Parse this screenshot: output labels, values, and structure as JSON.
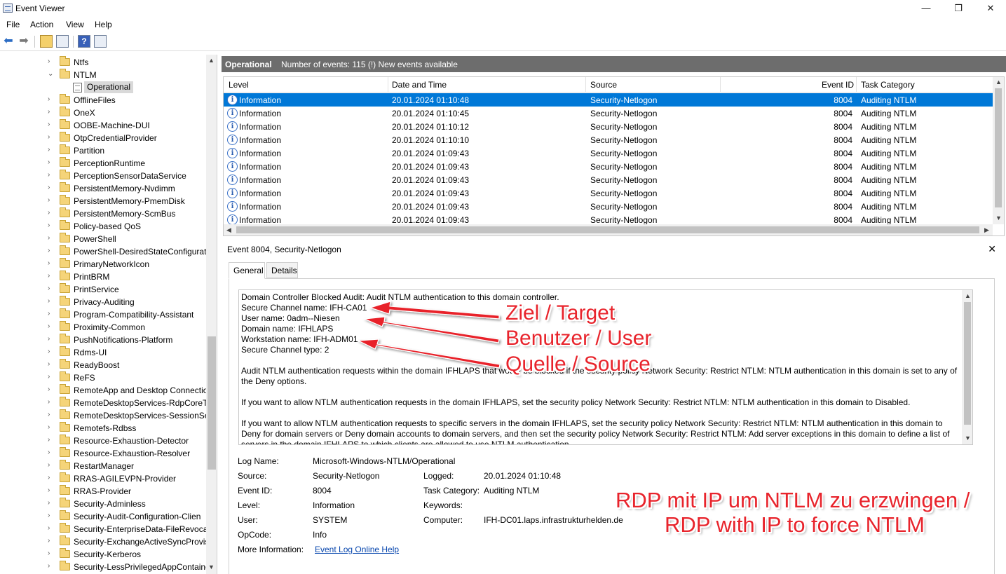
{
  "window": {
    "title": "Event Viewer",
    "minimize": "—",
    "maximize": "❐",
    "close": "✕"
  },
  "menu": [
    "File",
    "Action",
    "View",
    "Help"
  ],
  "tree": {
    "items": [
      {
        "label": "Ntfs",
        "expanded": false
      },
      {
        "label": "NTLM",
        "expanded": true
      },
      {
        "label": "Operational",
        "selected": true
      },
      {
        "label": "OfflineFiles"
      },
      {
        "label": "OneX"
      },
      {
        "label": "OOBE-Machine-DUI"
      },
      {
        "label": "OtpCredentialProvider"
      },
      {
        "label": "Partition"
      },
      {
        "label": "PerceptionRuntime"
      },
      {
        "label": "PerceptionSensorDataService"
      },
      {
        "label": "PersistentMemory-Nvdimm"
      },
      {
        "label": "PersistentMemory-PmemDisk"
      },
      {
        "label": "PersistentMemory-ScmBus"
      },
      {
        "label": "Policy-based QoS"
      },
      {
        "label": "PowerShell"
      },
      {
        "label": "PowerShell-DesiredStateConfigurati"
      },
      {
        "label": "PrimaryNetworkIcon"
      },
      {
        "label": "PrintBRM"
      },
      {
        "label": "PrintService"
      },
      {
        "label": "Privacy-Auditing"
      },
      {
        "label": "Program-Compatibility-Assistant"
      },
      {
        "label": "Proximity-Common"
      },
      {
        "label": "PushNotifications-Platform"
      },
      {
        "label": "Rdms-UI"
      },
      {
        "label": "ReadyBoost"
      },
      {
        "label": "ReFS"
      },
      {
        "label": "RemoteApp and Desktop Connectio"
      },
      {
        "label": "RemoteDesktopServices-RdpCoreTS"
      },
      {
        "label": "RemoteDesktopServices-SessionSer"
      },
      {
        "label": "Remotefs-Rdbss"
      },
      {
        "label": "Resource-Exhaustion-Detector"
      },
      {
        "label": "Resource-Exhaustion-Resolver"
      },
      {
        "label": "RestartManager"
      },
      {
        "label": "RRAS-AGILEVPN-Provider"
      },
      {
        "label": "RRAS-Provider"
      },
      {
        "label": "Security-Adminless"
      },
      {
        "label": "Security-Audit-Configuration-Clien"
      },
      {
        "label": "Security-EnterpriseData-FileRevocat"
      },
      {
        "label": "Security-ExchangeActiveSyncProvis"
      },
      {
        "label": "Security-Kerberos"
      },
      {
        "label": "Security-LessPrivilegedAppContainer"
      }
    ]
  },
  "log_header": {
    "name": "Operational",
    "summary": "Number of events: 115 (!) New events available"
  },
  "grid": {
    "columns": [
      "Level",
      "Date and Time",
      "Source",
      "Event ID",
      "Task Category"
    ],
    "rows": [
      {
        "level": "Information",
        "date": "20.01.2024 01:10:48",
        "source": "Security-Netlogon",
        "id": "8004",
        "cat": "Auditing NTLM",
        "selected": true
      },
      {
        "level": "Information",
        "date": "20.01.2024 01:10:45",
        "source": "Security-Netlogon",
        "id": "8004",
        "cat": "Auditing NTLM"
      },
      {
        "level": "Information",
        "date": "20.01.2024 01:10:12",
        "source": "Security-Netlogon",
        "id": "8004",
        "cat": "Auditing NTLM"
      },
      {
        "level": "Information",
        "date": "20.01.2024 01:10:10",
        "source": "Security-Netlogon",
        "id": "8004",
        "cat": "Auditing NTLM"
      },
      {
        "level": "Information",
        "date": "20.01.2024 01:09:43",
        "source": "Security-Netlogon",
        "id": "8004",
        "cat": "Auditing NTLM"
      },
      {
        "level": "Information",
        "date": "20.01.2024 01:09:43",
        "source": "Security-Netlogon",
        "id": "8004",
        "cat": "Auditing NTLM"
      },
      {
        "level": "Information",
        "date": "20.01.2024 01:09:43",
        "source": "Security-Netlogon",
        "id": "8004",
        "cat": "Auditing NTLM"
      },
      {
        "level": "Information",
        "date": "20.01.2024 01:09:43",
        "source": "Security-Netlogon",
        "id": "8004",
        "cat": "Auditing NTLM"
      },
      {
        "level": "Information",
        "date": "20.01.2024 01:09:43",
        "source": "Security-Netlogon",
        "id": "8004",
        "cat": "Auditing NTLM"
      },
      {
        "level": "Information",
        "date": "20.01.2024 01:09:43",
        "source": "Security-Netlogon",
        "id": "8004",
        "cat": "Auditing NTLM"
      }
    ]
  },
  "detail": {
    "title": "Event 8004, Security-Netlogon",
    "close": "✕",
    "tabs": [
      "General",
      "Details"
    ],
    "lines": [
      "Domain Controller Blocked Audit: Audit NTLM authentication to this domain controller.",
      "Secure Channel name: IFH-CA01",
      "User name: 0adm--Niesen",
      "Domain name: IFHLAPS",
      "Workstation name: IFH-ADM01",
      "Secure Channel type: 2"
    ],
    "paragraphs": [
      "Audit NTLM authentication requests within the domain IFHLAPS that would be blocked if the security policy Network Security: Restrict NTLM: NTLM authentication in this domain is set to any of the Deny options.",
      "If you want to allow NTLM authentication requests in the domain IFHLAPS, set the security policy Network Security: Restrict NTLM: NTLM authentication in this domain to Disabled.",
      "If you want to allow NTLM authentication requests to specific servers in the domain IFHLAPS, set the security policy Network Security: Restrict NTLM: NTLM authentication in this domain to Deny for domain servers or Deny domain accounts to domain servers, and then set the security policy Network Security: Restrict NTLM: Add server exceptions in this domain to define a list of servers in the domain IFHLAPS to which clients are allowed to use NTLM authentication."
    ],
    "props": {
      "log_name_label": "Log Name:",
      "log_name": "Microsoft-Windows-NTLM/Operational",
      "source_label": "Source:",
      "source": "Security-Netlogon",
      "logged_label": "Logged:",
      "logged": "20.01.2024 01:10:48",
      "event_id_label": "Event ID:",
      "event_id": "8004",
      "task_label": "Task Category:",
      "task": "Auditing NTLM",
      "level_label": "Level:",
      "level": "Information",
      "keywords_label": "Keywords:",
      "user_label": "User:",
      "user": "SYSTEM",
      "computer_label": "Computer:",
      "computer": "IFH-DC01.laps.infrastrukturhelden.de",
      "opcode_label": "OpCode:",
      "opcode": "Info",
      "more_label": "More Information:",
      "more_link": "Event Log Online Help"
    }
  },
  "annotations": {
    "target": "Ziel / Target",
    "user": "Benutzer / User",
    "source": "Quelle / Source",
    "rdp_line1": "RDP mit IP um NTLM zu erzwingen /",
    "rdp_line2": "RDP with IP to force NTLM",
    "color": "#e8242c"
  }
}
